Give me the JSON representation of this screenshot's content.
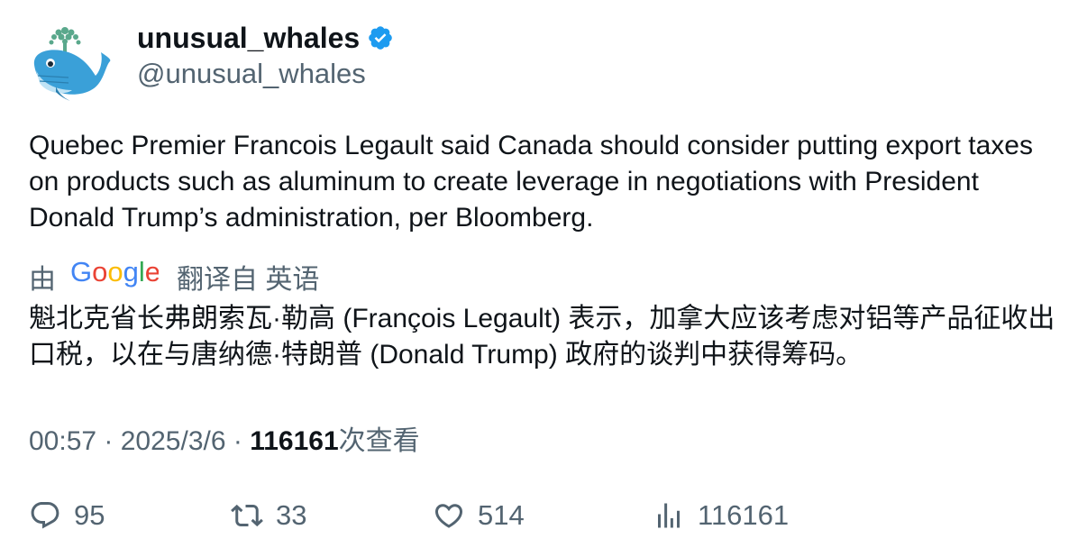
{
  "author": {
    "display_name": "unusual_whales",
    "handle": "@unusual_whales",
    "verified": true,
    "verified_color": "#1d9bf0"
  },
  "tweet": {
    "text": "Quebec Premier Francois Legault said Canada should consider putting export taxes on products such as aluminum to create leverage in negotiations with President Donald Trump’s administration, per Bloomberg."
  },
  "translation": {
    "prefix": "由",
    "provider": "Google",
    "suffix": "翻译自 英语",
    "text": "魁北克省长弗朗索瓦·勒高 (François Legault) 表示，加拿大应该考虑对铝等产品征收出口税，以在与唐纳德·特朗普 (Donald Trump) 政府的谈判中获得筹码。"
  },
  "meta": {
    "time": "00:57",
    "separator": "·",
    "date": "2025/3/6",
    "views": "116161",
    "views_label": "次查看"
  },
  "actions": {
    "replies": "95",
    "retweets": "33",
    "likes": "514",
    "views": "116161"
  },
  "icons": [
    "reply-icon",
    "retweet-icon",
    "like-icon",
    "views-icon",
    "verified-badge-icon",
    "google-logo"
  ]
}
